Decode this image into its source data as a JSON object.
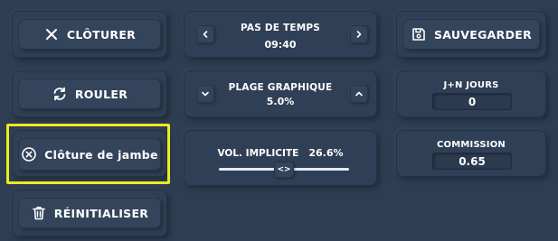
{
  "buttons": {
    "close_label": "CLÔTURER",
    "roll_label": "ROULER",
    "leg_close_label": "Clôture de jambe",
    "reset_label": "RÉINITIALISER",
    "save_label": "SAUVEGARDER"
  },
  "time_step": {
    "title": "PAS DE TEMPS",
    "value": "09:40"
  },
  "chart_range": {
    "title": "PLAGE GRAPHIQUE",
    "value": "5.0%"
  },
  "implied_vol": {
    "title": "VOL. IMPLICITE",
    "value": "26.6%",
    "slider_fraction": 0.5,
    "thumb_glyph": "<>"
  },
  "days": {
    "title": "J+N JOURS",
    "value": "0"
  },
  "commission": {
    "title": "COMMISSION",
    "value": "0.65"
  },
  "icons": {
    "close": "x-icon",
    "roll": "refresh-icon",
    "leg_close": "circle-x-icon",
    "reset": "trash-icon",
    "save": "floppy-disk-icon"
  },
  "colors": {
    "background": "#2e3d52",
    "highlight": "#ecec1e",
    "text": "#ffffff"
  }
}
